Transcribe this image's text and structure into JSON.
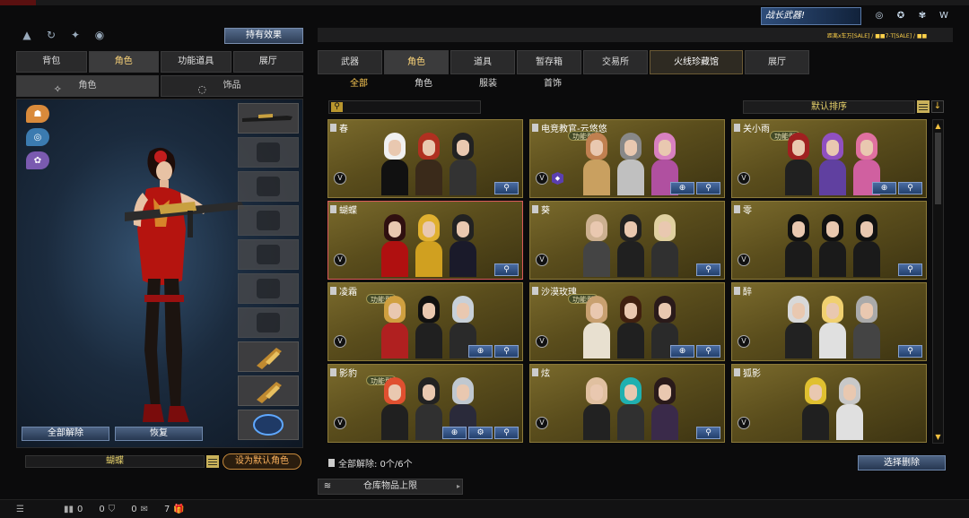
{
  "header": {
    "top_icons": [
      "bag-rank-icon",
      "refresh-icon",
      "skill-icon",
      "gift-icon"
    ],
    "effect_button": "持有效果",
    "brand_button": "战长武器!",
    "brand_icons": [
      "target-icon",
      "award-icon",
      "fox-icon",
      "w-logo-icon"
    ],
    "ticker": "距离x车万[SALE] / ■■7-T[SALE] / ■■"
  },
  "left_panel": {
    "tabs": [
      {
        "label": "背包",
        "active": false
      },
      {
        "label": "角色",
        "active": true
      },
      {
        "label": "功能道具",
        "active": false
      },
      {
        "label": "展厅",
        "active": false
      }
    ],
    "subtabs": [
      {
        "label": "角色",
        "icon": "character-icon",
        "active": true
      },
      {
        "label": "饰品",
        "icon": "accessory-icon",
        "active": false
      }
    ],
    "badges": [
      "rank-badge",
      "eye-badge",
      "wing-badge"
    ],
    "equip_slots": [
      "rifle-slot",
      "helmet-slot",
      "goggles-slot",
      "vest-slot",
      "backpack-slot",
      "armor-slot",
      "boots-slot",
      "grenade-slot",
      "knife-slot",
      "medal-slot"
    ],
    "unequip_all": "全部解除",
    "restore": "恢复",
    "character_name": "蝴蝶",
    "set_default": "设为默认角色"
  },
  "right_panel": {
    "tabs": [
      {
        "label": "武器",
        "active": false
      },
      {
        "label": "角色",
        "active": true
      },
      {
        "label": "道具",
        "active": false
      },
      {
        "label": "暂存箱",
        "active": false
      },
      {
        "label": "交易所",
        "active": false
      },
      {
        "label": "火线珍藏馆",
        "active": false,
        "gold": true
      },
      {
        "label": "展厅",
        "active": false
      }
    ],
    "subtabs": [
      {
        "label": "全部",
        "active": true
      },
      {
        "label": "角色",
        "active": false
      },
      {
        "label": "服装",
        "active": false
      },
      {
        "label": "首饰",
        "active": false
      }
    ],
    "search_placeholder": "",
    "sort_label": "默认排序",
    "cards": [
      {
        "title": "春",
        "tag": "",
        "buttons": [
          "search"
        ],
        "extra_badge": false,
        "hair": [
          "#f0f0f0",
          "#b03020",
          "#222"
        ],
        "cloth": [
          "#111",
          "#3a2a1a",
          "#333"
        ]
      },
      {
        "title": "电竞教官-云悠悠",
        "tag": "功能型",
        "buttons": [
          "magnify-plus",
          "search"
        ],
        "extra_badge": true,
        "hair": [
          "#c08050",
          "#888",
          "#d880c0"
        ],
        "cloth": [
          "#c9a060",
          "#c0c0c0",
          "#b050a0"
        ]
      },
      {
        "title": "关小雨",
        "tag": "功能型",
        "buttons": [
          "magnify-plus",
          "search"
        ],
        "extra_badge": false,
        "hair": [
          "#a02020",
          "#9050c0",
          "#e070a0"
        ],
        "cloth": [
          "#202020",
          "#6040a0",
          "#d060a0"
        ]
      },
      {
        "title": "蝴蝶",
        "tag": "",
        "buttons": [
          "search"
        ],
        "extra_badge": false,
        "hair": [
          "#301010",
          "#e0b030",
          "#222"
        ],
        "cloth": [
          "#b01010",
          "#d0a020",
          "#1a1a2a"
        ]
      },
      {
        "title": "葵",
        "tag": "",
        "buttons": [
          "search"
        ],
        "extra_badge": false,
        "hair": [
          "#ccb090",
          "#222",
          "#e0d0a0"
        ],
        "cloth": [
          "#444",
          "#202020",
          "#303030"
        ]
      },
      {
        "title": "零",
        "tag": "",
        "buttons": [
          "search"
        ],
        "extra_badge": false,
        "hair": [
          "#111",
          "#111",
          "#111"
        ],
        "cloth": [
          "#1a1a1a",
          "#1a1a1a",
          "#1a1a1a"
        ]
      },
      {
        "title": "凌霜",
        "tag": "功能型",
        "buttons": [
          "magnify-plus",
          "search"
        ],
        "extra_badge": false,
        "hair": [
          "#d0a040",
          "#111",
          "#c8d0d8"
        ],
        "cloth": [
          "#b02020",
          "#202020",
          "#2a2a2a"
        ]
      },
      {
        "title": "沙漠玫瑰",
        "tag": "功能型",
        "buttons": [
          "magnify-plus",
          "search"
        ],
        "extra_badge": false,
        "hair": [
          "#c8a070",
          "#402010",
          "#2a1a1a"
        ],
        "cloth": [
          "#e8e0d0",
          "#202020",
          "#2a2a2a"
        ]
      },
      {
        "title": "醉",
        "tag": "",
        "buttons": [
          "search"
        ],
        "extra_badge": false,
        "hair": [
          "#d8d8d8",
          "#f0d070",
          "#aaa"
        ],
        "cloth": [
          "#222",
          "#e0e0e0",
          "#444"
        ]
      },
      {
        "title": "影豹",
        "tag": "功能型",
        "buttons": [
          "magnify-plus",
          "gear",
          "search"
        ],
        "extra_badge": false,
        "hair": [
          "#e05030",
          "#222",
          "#c0c8d0"
        ],
        "cloth": [
          "#202020",
          "#303030",
          "#2a2a3a"
        ]
      },
      {
        "title": "炫",
        "tag": "",
        "buttons": [
          "search"
        ],
        "extra_badge": false,
        "hair": [
          "#e0c0a0",
          "#20b0b0",
          "#2a1a1a"
        ],
        "cloth": [
          "#222",
          "#303030",
          "#3a2a4a"
        ]
      },
      {
        "title": "狐影",
        "tag": "",
        "buttons": [],
        "extra_badge": false,
        "hair": [
          "#e0c030",
          "#c8c8c8"
        ],
        "cloth": [
          "#202020",
          "#e0e0e0"
        ]
      }
    ],
    "bulk_label": "全部解除: 0个/6个",
    "select_delete": "选择删除",
    "warehouse_label": "仓库物品上限"
  },
  "bottom_bar": [
    {
      "icon": "menu-icon",
      "value": ""
    },
    {
      "icon": "bag-icon",
      "value": "0"
    },
    {
      "icon": "shield-icon",
      "value": "0"
    },
    {
      "icon": "chat-icon",
      "value": "0"
    },
    {
      "icon": "gift-icon",
      "value": "7"
    }
  ]
}
